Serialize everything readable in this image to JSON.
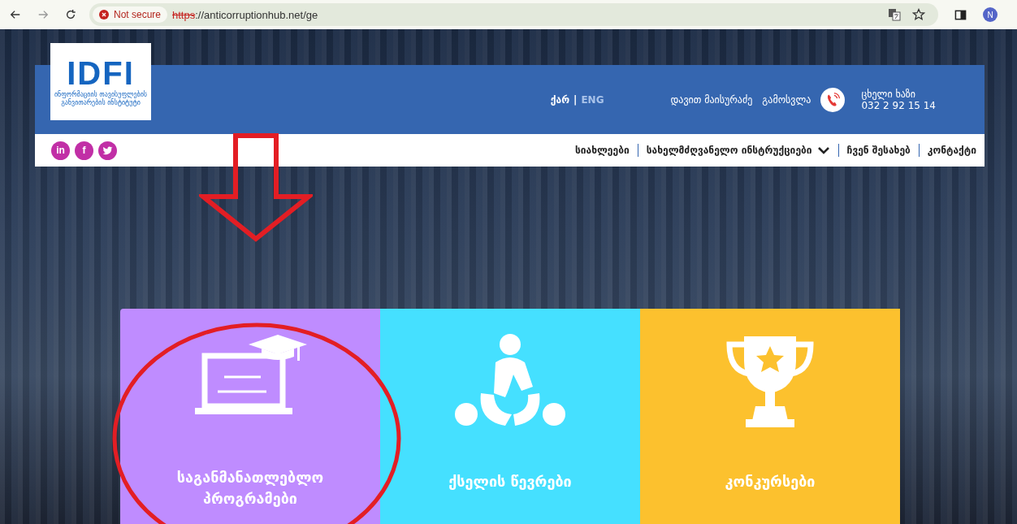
{
  "browser": {
    "security_label": "Not secure",
    "url_scheme": "https",
    "url_rest": "://anticorruptionhub.net/ge",
    "profile_initial": "N"
  },
  "header": {
    "logo_text": "IDFI",
    "logo_subtitle": "ინფორმაციის თავისუფლების განვითარების ინსტიტუტი",
    "languages": [
      {
        "label": "ქარ",
        "selected": true
      },
      {
        "label": "ENG",
        "selected": false
      }
    ],
    "language_separator": "|",
    "user_name": "დავით მაისურაძე",
    "logout": "გამოსვლა",
    "hotline_label": "ცხელი ხაზი",
    "hotline_number": "032 2 92 15 14"
  },
  "social": [
    {
      "kind": "linkedin",
      "glyph": "in"
    },
    {
      "kind": "facebook",
      "glyph": "f"
    },
    {
      "kind": "twitter"
    }
  ],
  "nav": [
    {
      "label": "სიახლეები",
      "dropdown": false
    },
    {
      "label": "სახელმძღვანელო ინსტრუქციები",
      "dropdown": true
    },
    {
      "label": "ჩვენ შესახებ",
      "dropdown": false
    },
    {
      "label": "კონტაქტი",
      "dropdown": false
    }
  ],
  "tiles": [
    {
      "kind": "education",
      "label": "საგანმანათლებლო პროგრამები",
      "color": "#bf8cff",
      "highlighted": true
    },
    {
      "kind": "network",
      "label": "ქსელის წევრები",
      "color": "#45e0ff",
      "highlighted": false
    },
    {
      "kind": "contests",
      "label": "კონკურსები",
      "color": "#fcc12e",
      "highlighted": false
    }
  ],
  "annotation": {
    "arrow": true
  }
}
